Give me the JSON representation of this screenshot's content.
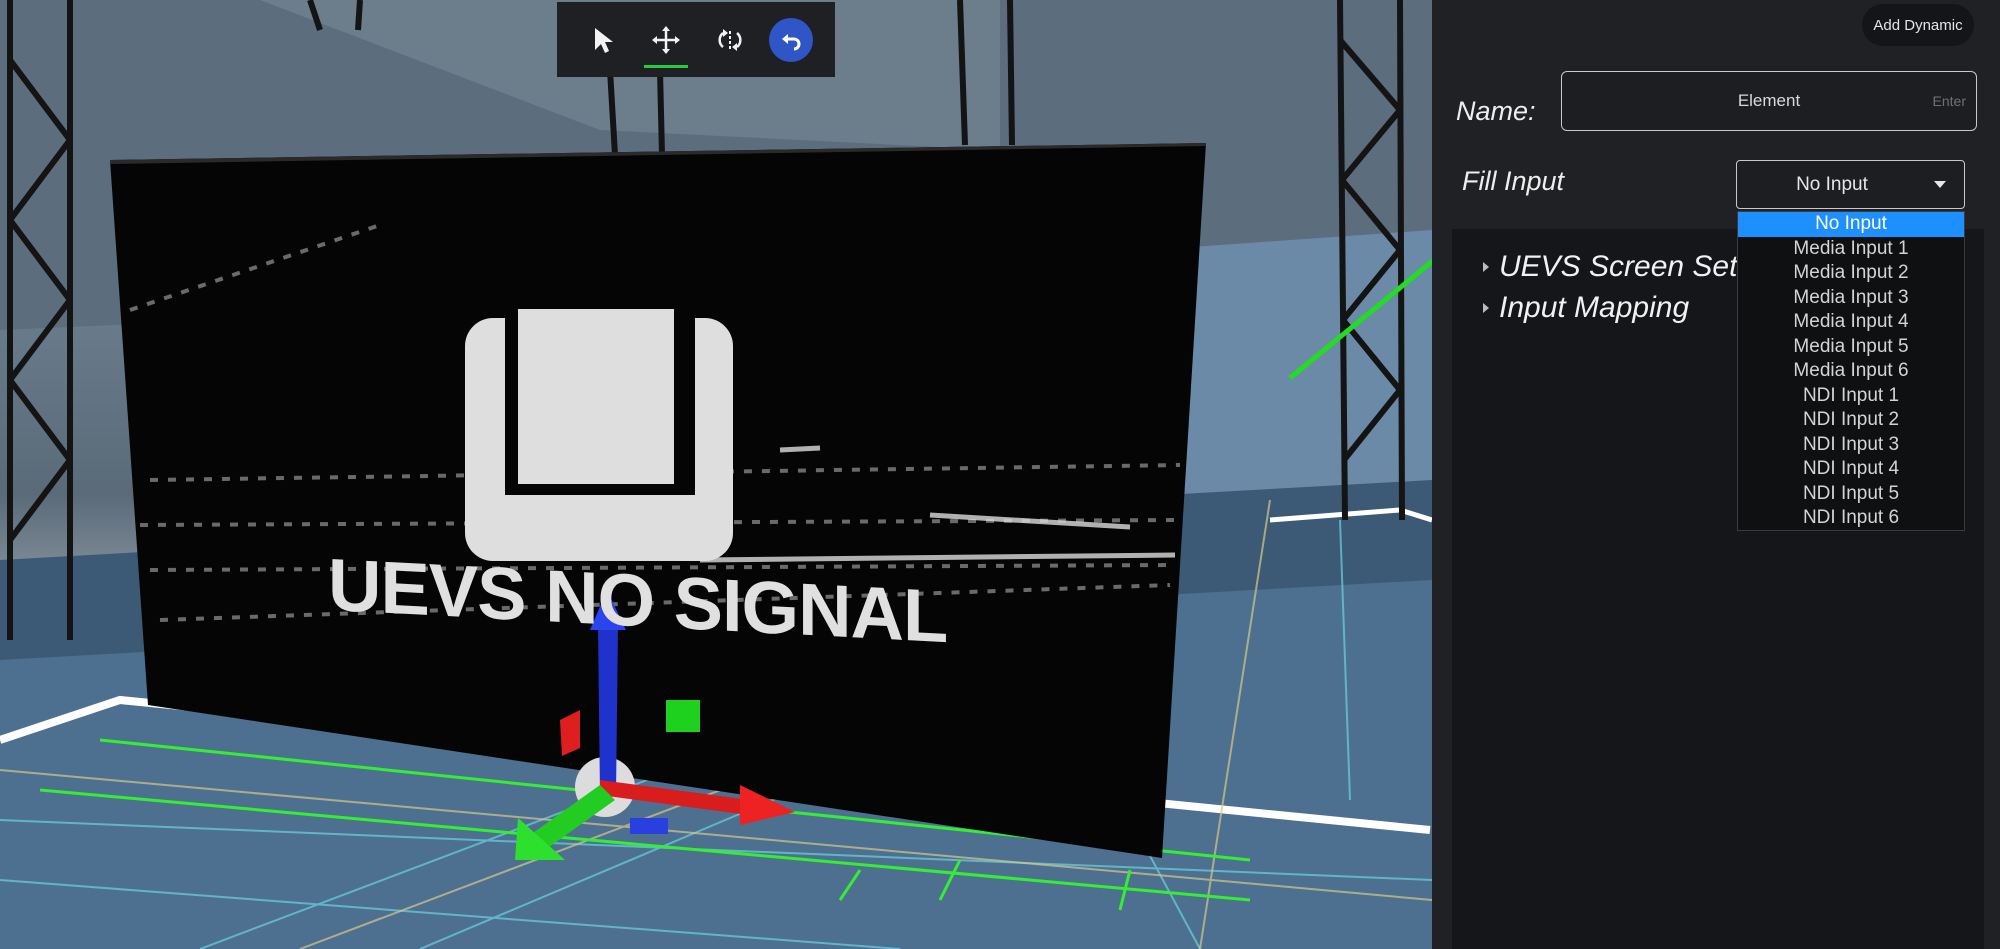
{
  "toolbar": {
    "tools": [
      {
        "icon": "select-arrow-icon",
        "active": false
      },
      {
        "icon": "move-arrows-icon",
        "active": true
      },
      {
        "icon": "rotate-icon",
        "active": false
      },
      {
        "icon": "undo-icon",
        "active": false
      }
    ],
    "accent_color": "#27c93f",
    "undo_color": "#2f55c6"
  },
  "viewport": {
    "screen_text": "UEVS NO SIGNAL"
  },
  "panel": {
    "add_dynamic_label": "Add Dynamic",
    "name_label": "Name:",
    "name_value": "Element",
    "name_hint": "Enter",
    "fill_input_label": "Fill Input",
    "fill_input_value": "No Input",
    "tree": [
      {
        "label": "UEVS Screen Setti"
      },
      {
        "label": "Input Mapping"
      }
    ],
    "dropdown_options": [
      "No Input",
      "Media Input 1",
      "Media Input 2",
      "Media Input 3",
      "Media Input 4",
      "Media Input 5",
      "Media Input 6",
      "NDI Input 1",
      "NDI Input 2",
      "NDI Input 3",
      "NDI Input 4",
      "NDI Input 5",
      "NDI Input 6"
    ],
    "selected_option": "No Input",
    "highlight_color": "#1e8fff"
  },
  "annotation": {
    "arrow_color": "#22dd22"
  }
}
